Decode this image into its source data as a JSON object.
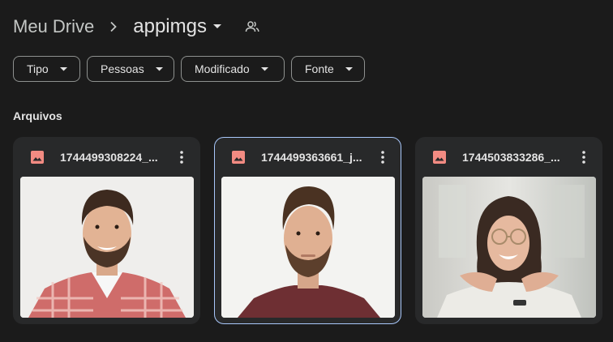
{
  "header": {
    "root": "Meu Drive",
    "current_folder": "appimgs",
    "icons": {
      "separator": "chevron-right-icon",
      "caret": "caret-down-icon",
      "shared": "shared-people-icon"
    }
  },
  "filters": [
    {
      "label": "Tipo"
    },
    {
      "label": "Pessoas"
    },
    {
      "label": "Modificado"
    },
    {
      "label": "Fonte"
    }
  ],
  "section_title": "Arquivos",
  "files": [
    {
      "name": "1744499308224_...",
      "icon": "image-file-icon",
      "selected": false,
      "thumbnail": "man-plaid-shirt-smiling"
    },
    {
      "name": "1744499363661_j...",
      "icon": "image-file-icon",
      "selected": true,
      "thumbnail": "man-beard-portrait"
    },
    {
      "name": "1744503833286_...",
      "icon": "image-file-icon",
      "selected": false,
      "thumbnail": "woman-glasses-smiling"
    }
  ],
  "colors": {
    "background": "#1b1b1b",
    "card": "#28292a",
    "selected_border": "#a8c7fa",
    "image_icon": "#f28b82"
  }
}
